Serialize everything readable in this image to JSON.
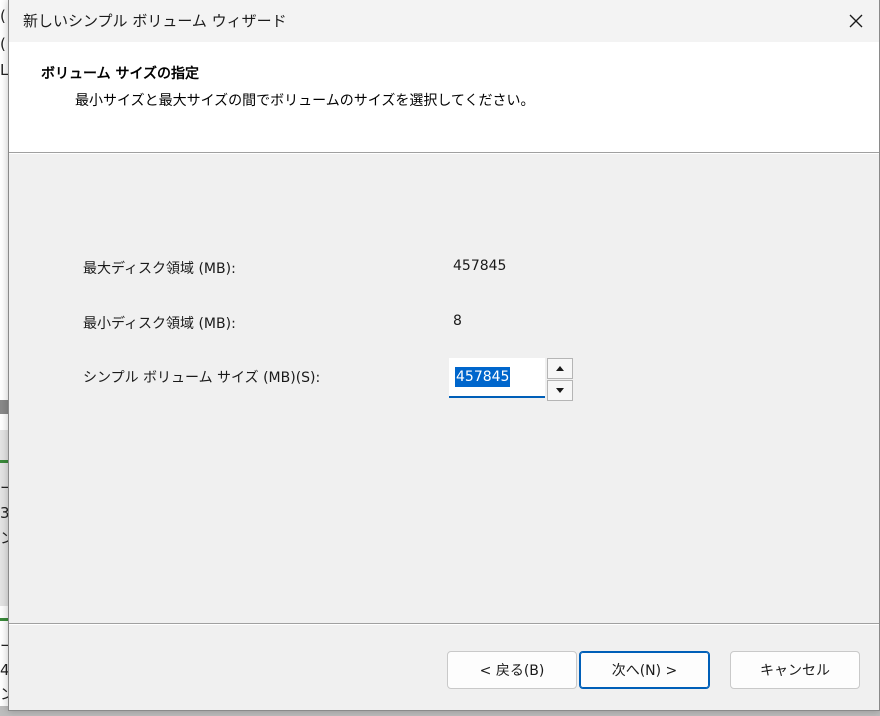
{
  "window": {
    "title": "新しいシンプル ボリューム ウィザード",
    "close_glyph": "✕"
  },
  "header": {
    "title": "ボリューム サイズの指定",
    "subtitle": "最小サイズと最大サイズの間でボリュームのサイズを選択してください。"
  },
  "rows": {
    "max": {
      "label": "最大ディスク領域 (MB):",
      "value": "457845"
    },
    "min": {
      "label": "最小ディスク領域 (MB):",
      "value": "8"
    },
    "size": {
      "label": "シンプル ボリューム サイズ (MB)(S):",
      "value": "457845"
    }
  },
  "spinner": {
    "up_glyph": "▲",
    "down_glyph": "▼"
  },
  "buttons": {
    "back": "< 戻る(B)",
    "next": "次へ(N) >",
    "cancel": "キャンセル"
  },
  "background_window": {
    "fragments": [
      "(",
      "(",
      "L",
      "ー",
      "3",
      "ン",
      "ー",
      "4",
      "ン"
    ]
  },
  "colors": {
    "accent": "#005fb8",
    "selection": "#0066cc"
  }
}
